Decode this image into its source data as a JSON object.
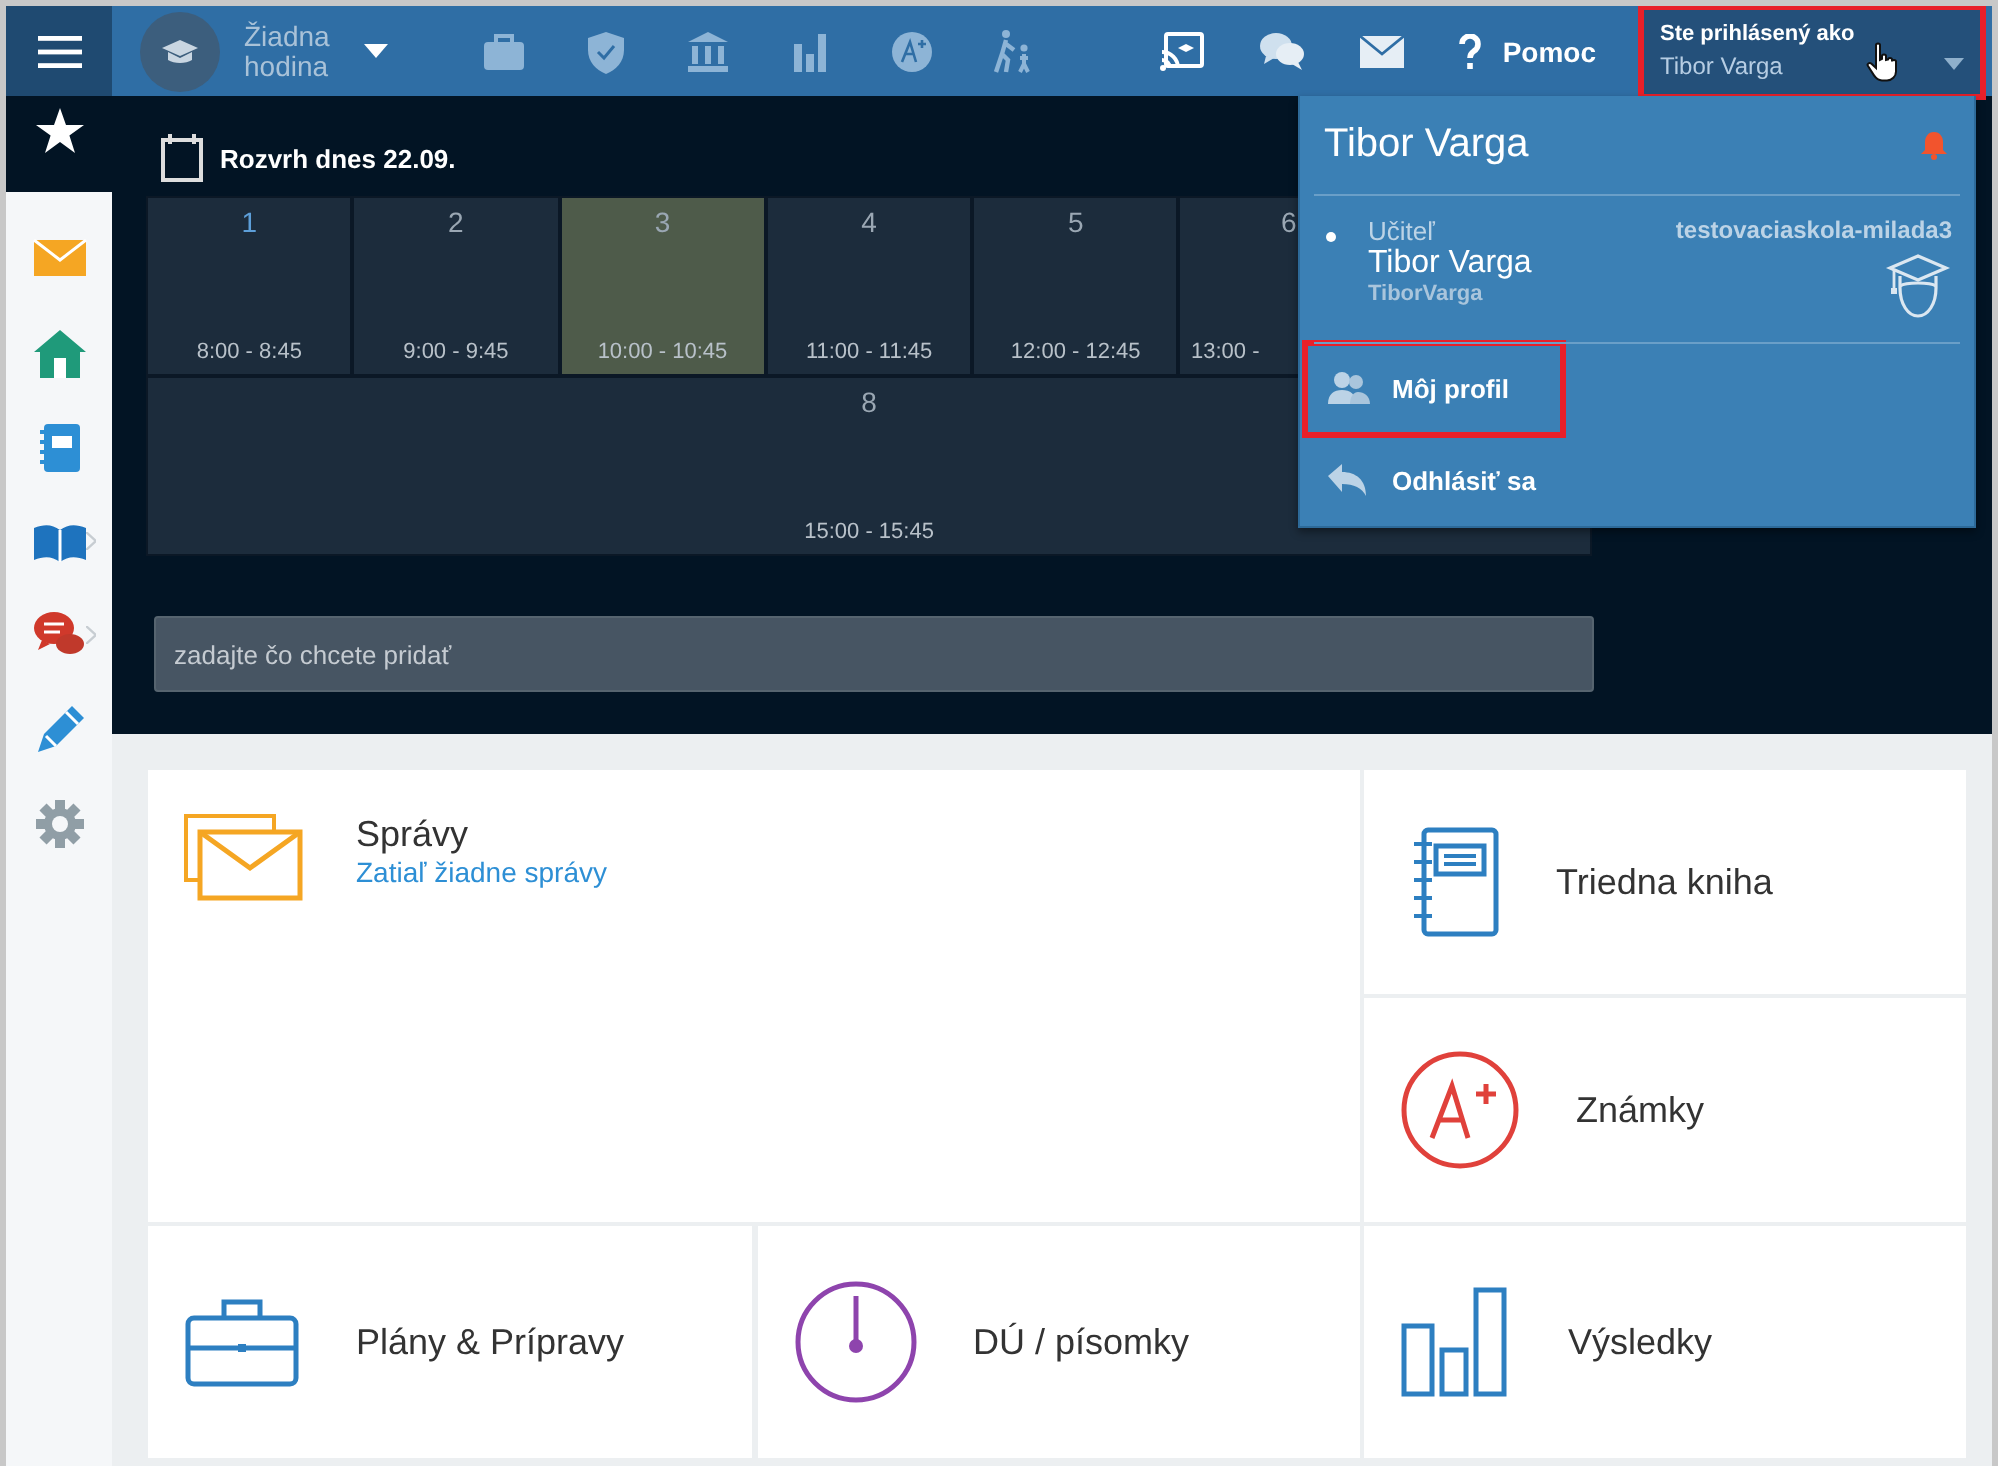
{
  "topbar": {
    "lesson_selector": {
      "label": "Žiadna hodina"
    },
    "help": {
      "label": "Pomoc"
    },
    "user_menu": {
      "caption": "Ste prihlásený ako",
      "name": "Tibor Varga",
      "highlighted": true
    }
  },
  "dropdown": {
    "name": "Tibor Varga",
    "account": {
      "role": "Učiteľ",
      "name": "Tibor Varga",
      "username": "TiborVarga",
      "school": "testovaciaskola-milada3",
      "selected": true
    },
    "items": [
      {
        "kind": "profile",
        "label": "Môj profil",
        "highlighted": true
      },
      {
        "kind": "logout",
        "label": "Odhlásiť sa",
        "highlighted": false
      }
    ]
  },
  "schedule": {
    "title": "Rozvrh dnes 22.09.",
    "lessons": [
      {
        "number": "1",
        "time": "8:00 - 8:45",
        "selected": false
      },
      {
        "number": "2",
        "time": "9:00 - 9:45",
        "selected": false
      },
      {
        "number": "3",
        "time": "10:00 - 10:45",
        "selected": true
      },
      {
        "number": "4",
        "time": "11:00 - 11:45",
        "selected": false
      },
      {
        "number": "5",
        "time": "12:00 - 12:45",
        "selected": false
      },
      {
        "number": "6",
        "time": "13:00 -",
        "selected": false,
        "cut": true
      },
      {
        "number": "8",
        "time": "15:00 - 15:45",
        "selected": false,
        "wide": true
      }
    ]
  },
  "add_field": {
    "placeholder": "zadajte čo chcete pridať"
  },
  "tiles": [
    {
      "kind": "messages",
      "title": "Správy",
      "subtitle": "Zatiaľ žiadne správy"
    },
    {
      "kind": "classbook",
      "title": "Triedna kniha"
    },
    {
      "kind": "grades",
      "title": "Známky"
    },
    {
      "kind": "plans",
      "title": "Plány & Prípravy"
    },
    {
      "kind": "homework",
      "title": "DÚ / písomky"
    },
    {
      "kind": "results",
      "title": "Výsledky"
    }
  ]
}
